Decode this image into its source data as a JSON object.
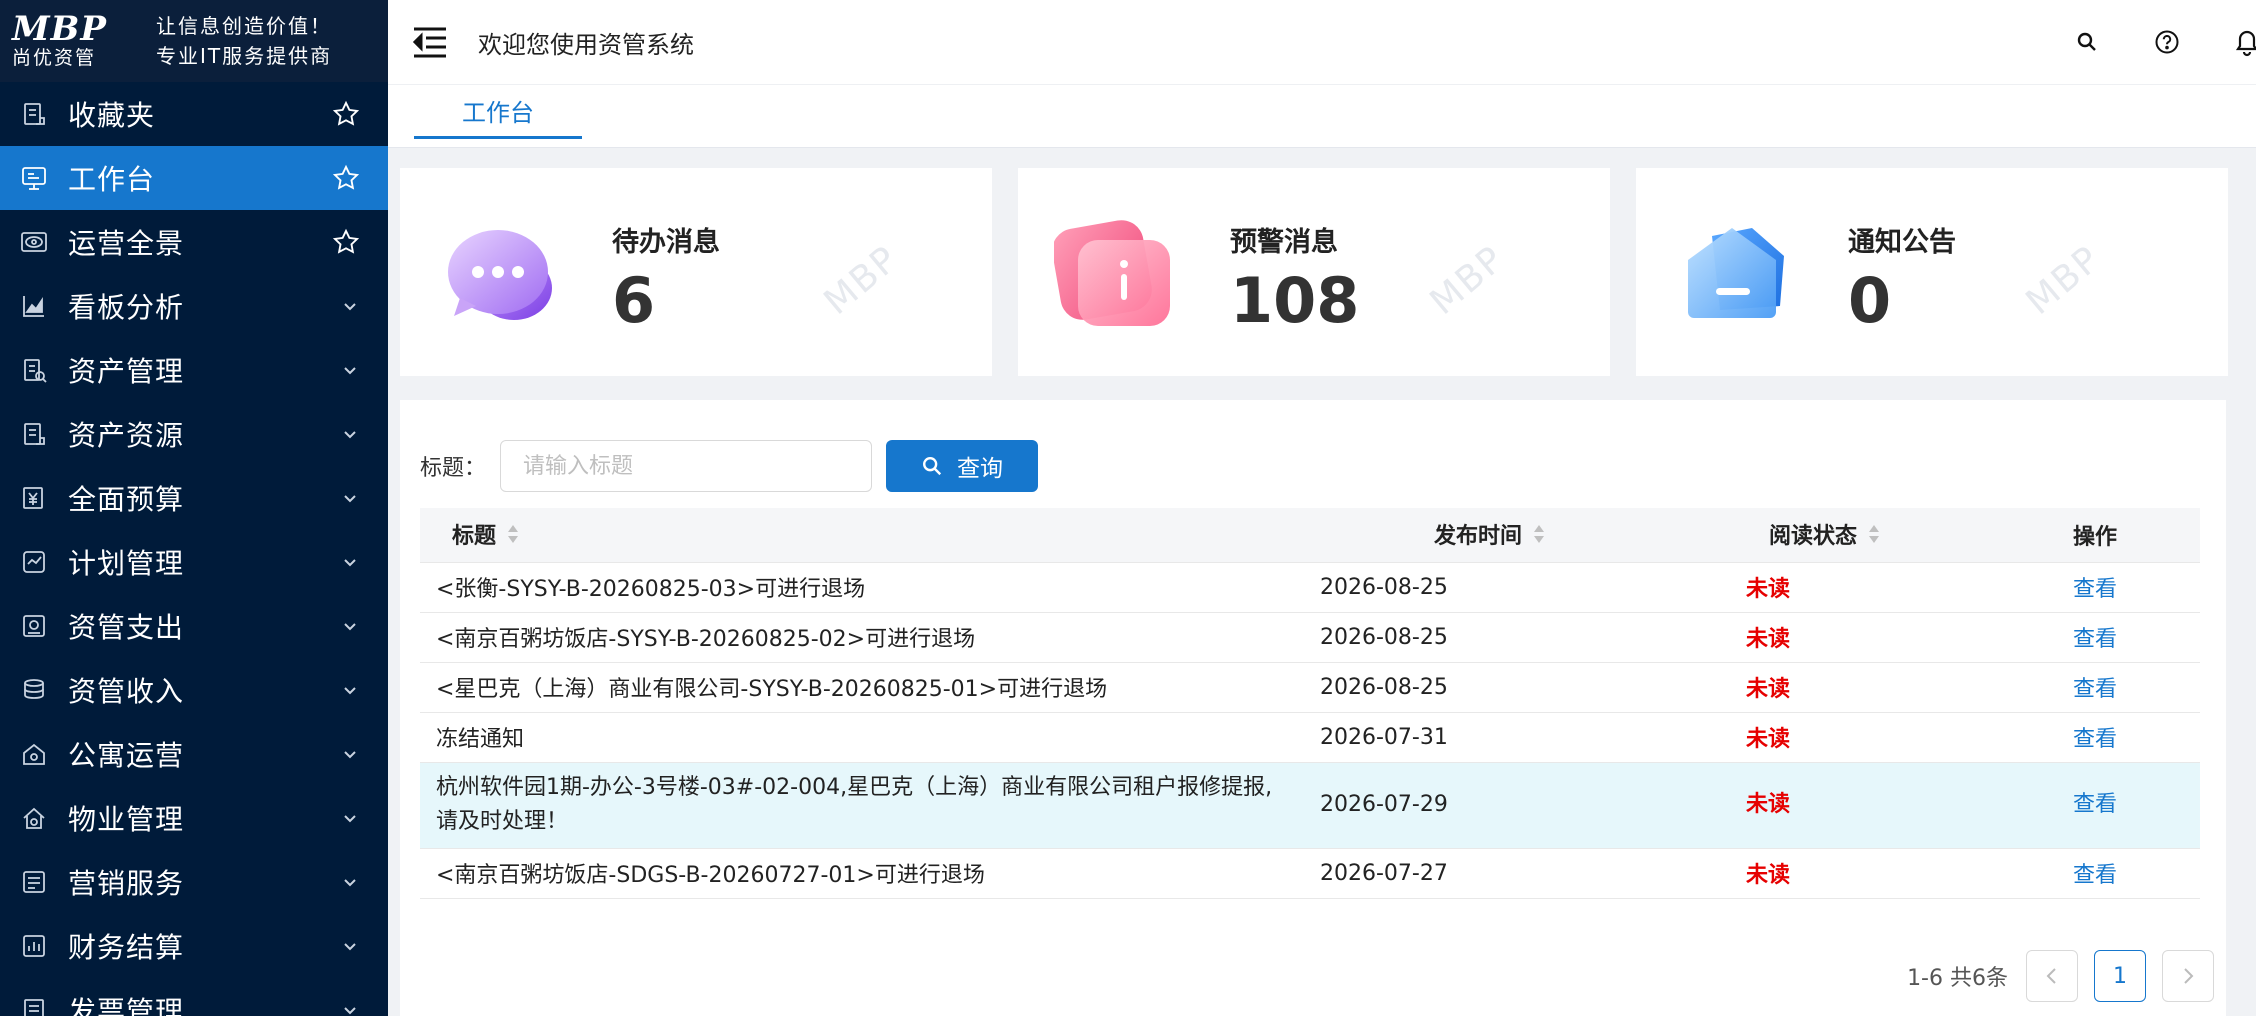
{
  "brand": {
    "logo": "MBP",
    "logo_sub": "尚优资管",
    "slogan1": "让信息创造价值！",
    "slogan2": "专业IT服务提供商"
  },
  "sidebar": {
    "items": [
      {
        "label": "收藏夹",
        "icon": "favorites-icon",
        "right": "star"
      },
      {
        "label": "工作台",
        "icon": "workbench-icon",
        "right": "star",
        "active": true
      },
      {
        "label": "运营全景",
        "icon": "eye-icon",
        "right": "star"
      },
      {
        "label": "看板分析",
        "icon": "chart-icon",
        "right": "chevron"
      },
      {
        "label": "资产管理",
        "icon": "asset-icon",
        "right": "chevron"
      },
      {
        "label": "资产资源",
        "icon": "resource-icon",
        "right": "chevron"
      },
      {
        "label": "全面预算",
        "icon": "budget-icon",
        "right": "chevron"
      },
      {
        "label": "计划管理",
        "icon": "plan-icon",
        "right": "chevron"
      },
      {
        "label": "资管支出",
        "icon": "expense-icon",
        "right": "chevron"
      },
      {
        "label": "资管收入",
        "icon": "income-icon",
        "right": "chevron"
      },
      {
        "label": "公寓运营",
        "icon": "apartment-icon",
        "right": "chevron"
      },
      {
        "label": "物业管理",
        "icon": "property-icon",
        "right": "chevron"
      },
      {
        "label": "营销服务",
        "icon": "marketing-icon",
        "right": "chevron"
      },
      {
        "label": "财务结算",
        "icon": "finance-icon",
        "right": "chevron"
      },
      {
        "label": "发票管理",
        "icon": "invoice-icon",
        "right": "chevron"
      }
    ]
  },
  "header": {
    "welcome": "欢迎您使用资管系统"
  },
  "tabs": {
    "active": "工作台"
  },
  "cards": [
    {
      "title": "待办消息",
      "value": "6",
      "watermark": "MBP"
    },
    {
      "title": "预警消息",
      "value": "108",
      "watermark": "MBP"
    },
    {
      "title": "通知公告",
      "value": "0",
      "watermark": "MBP"
    }
  ],
  "search": {
    "label": "标题：",
    "placeholder": "请输入标题",
    "button": "查询"
  },
  "table": {
    "headers": {
      "title": "标题",
      "date": "发布时间",
      "status": "阅读状态",
      "op": "操作"
    },
    "rows": [
      {
        "title": "<张衡-SYSY-B-20260825-03>可进行退场",
        "date": "2026-08-25",
        "status": "未读",
        "op": "查看"
      },
      {
        "title": "<南京百粥坊饭店-SYSY-B-20260825-02>可进行退场",
        "date": "2026-08-25",
        "status": "未读",
        "op": "查看"
      },
      {
        "title": "<星巴克（上海）商业有限公司-SYSY-B-20260825-01>可进行退场",
        "date": "2026-08-25",
        "status": "未读",
        "op": "查看"
      },
      {
        "title": "冻结通知",
        "date": "2026-07-31",
        "status": "未读",
        "op": "查看"
      },
      {
        "title": "杭州软件园1期-办公-3号楼-03#-02-004,星巴克（上海）商业有限公司租户报修提报,请及时处理！",
        "date": "2026-07-29",
        "status": "未读",
        "op": "查看"
      },
      {
        "title": "<南京百粥坊饭店-SDGS-B-20260727-01>可进行退场",
        "date": "2026-07-27",
        "status": "未读",
        "op": "查看"
      }
    ]
  },
  "pagination": {
    "total_text": "1-6 共6条",
    "current": "1"
  },
  "colors": {
    "primary": "#1677cd",
    "sidebar_bg": "#001b3a",
    "unread": "#e60000"
  }
}
